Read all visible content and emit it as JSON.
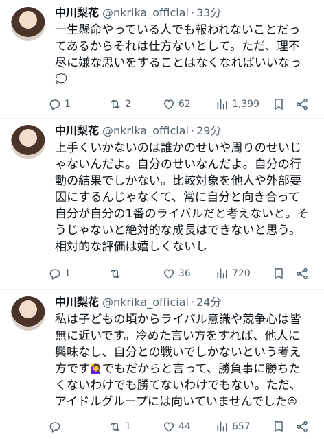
{
  "tweets": [
    {
      "name": "中川梨花",
      "handle": "@nkrika_official",
      "separator": "·",
      "time": "33分",
      "lines": [
        "一生懸命やっている人でも報われないことだっ",
        "てあるからそれは仕方ないとして。ただ、理不",
        "尽に嫌な思いをすることはなくなればいいなっ"
      ],
      "trailing_emoji": "💭",
      "replies": "1",
      "reposts": "2",
      "likes": "62",
      "views": "1,399"
    },
    {
      "name": "中川梨花",
      "handle": "@nkrika_official",
      "separator": "·",
      "time": "29分",
      "lines": [
        "上手くいかないのは誰かのせいや周りのせいじ",
        "ゃないんだよ。自分のせいなんだよ。自分の行",
        "動の結果でしかない。比較対象を他人や外部要",
        "因にするんじゃなくて、常に自分と向き合って",
        "自分が自分の1番のライバルだと考えないと。そ",
        "うじゃないと絶対的な成長はできないと思う。",
        "相対的な評価は嬉しくないし"
      ],
      "replies": "1",
      "reposts": "",
      "likes": "36",
      "views": "720"
    },
    {
      "name": "中川梨花",
      "handle": "@nkrika_official",
      "separator": "·",
      "time": "24分",
      "lines": [
        "私は子どもの頃からライバル意識や競争心は皆",
        "無に近いです。冷めた言い方をすれば、他人に",
        "興味なし、自分との戦いでしかないという考え"
      ],
      "line4_before": "方です",
      "line4_emoji": "🙋‍♀️",
      "line4_after": "でもだからと言って、勝負事に勝ちた",
      "lines_after": [
        "くないわけでも勝てないわけでもない。ただ、"
      ],
      "last_line": "アイドルグループには向いていませんでした",
      "last_emoji": "😔",
      "replies": "",
      "reposts": "1",
      "likes": "44",
      "views": "657"
    }
  ],
  "icons": [
    "reply-icon",
    "repost-icon",
    "like-icon",
    "views-icon",
    "bookmark-icon",
    "share-icon"
  ],
  "colors": {
    "text": "#0f1419",
    "secondary": "#536471",
    "divider": "#eff3f4"
  }
}
